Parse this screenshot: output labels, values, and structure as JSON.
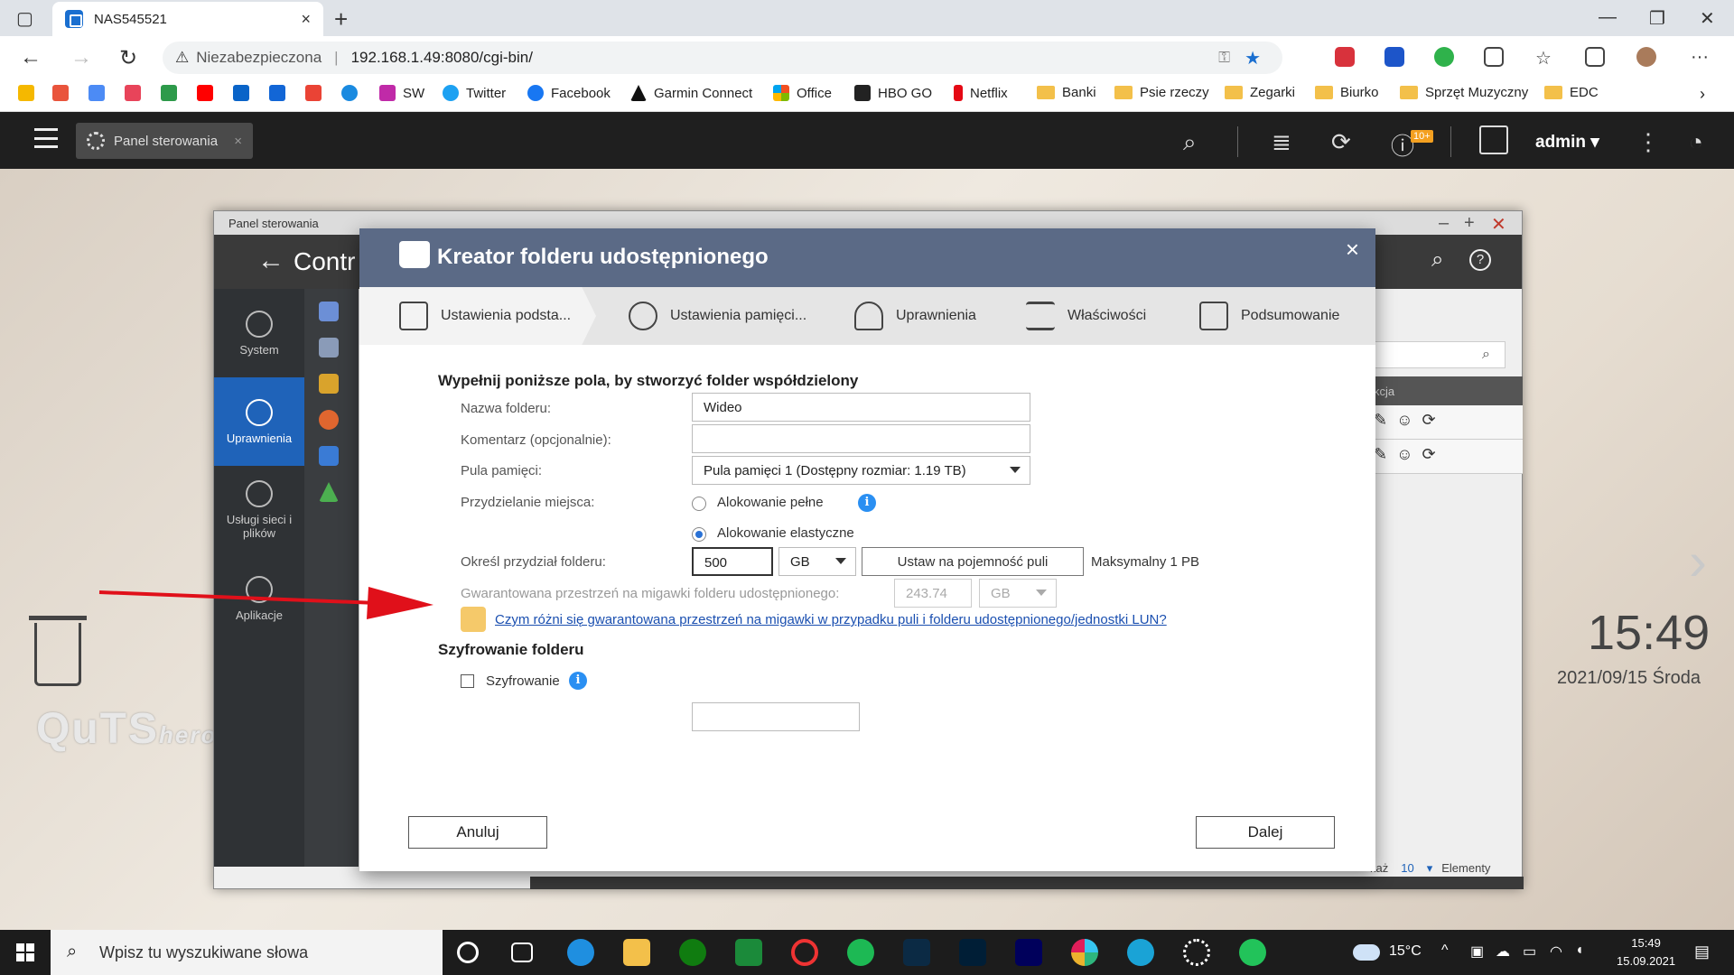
{
  "browser": {
    "tab_title": "NAS545521",
    "tab_close": "×",
    "new_tab": "+",
    "insecure_label": "Niezabezpieczona",
    "url": "192.168.1.49:8080/cgi-bin/",
    "bookmarks": [
      "SW",
      "Twitter",
      "Facebook",
      "Garmin Connect",
      "Office",
      "HBO GO",
      "Netflix",
      "Banki",
      "Psie rzeczy",
      "Zegarki",
      "Biurko",
      "Sprzęt Muzyczny",
      "EDC"
    ]
  },
  "qts": {
    "app_tab": "Panel sterowania",
    "app_tab_close": "×",
    "badge": "10+",
    "user": "admin ▾"
  },
  "control_panel": {
    "window_title": "Panel sterowania",
    "header_title": "Contr",
    "sidebar": [
      "System",
      "Uprawnienia",
      "Usługi sieci i plików",
      "Aplikacje"
    ],
    "column_header": "kcja",
    "footer_show": "każ",
    "footer_count": "10",
    "footer_items": "Elementy"
  },
  "modal": {
    "title": "Kreator folderu udostępnionego",
    "steps": [
      "Ustawienia podsta...",
      "Ustawienia pamięci...",
      "Uprawnienia",
      "Właściwości",
      "Podsumowanie"
    ],
    "heading": "Wypełnij poniższe pola, by stworzyć folder współdzielony",
    "folder_name_label": "Nazwa folderu:",
    "folder_name_value": "Wideo",
    "comment_label": "Komentarz (opcjonalnie):",
    "comment_value": "",
    "pool_label": "Pula pamięci:",
    "pool_value": "Pula pamięci 1 (Dostępny rozmiar: 1.19 TB)",
    "alloc_label": "Przydzielanie miejsca:",
    "alloc_full": "Alokowanie pełne",
    "alloc_thin": "Alokowanie elastyczne",
    "alloc_selected": "Alokowanie elastyczne",
    "quota_label": "Określ przydział folderu:",
    "quota_value": "500",
    "quota_unit": "GB",
    "set_pool_button": "Ustaw na pojemność puli",
    "max_label": "Maksymalny  1 PB",
    "snapshot_label": "Gwarantowana przestrzeń na migawki folderu udostępnionego:",
    "snapshot_value": "243.74",
    "snapshot_unit": "GB",
    "help_link": "Czym różni się gwarantowana przestrzeń na migawki w przypadku puli i folderu udostępnionego/jednostki LUN?",
    "encryption_heading": "Szyfrowanie folderu",
    "encryption_label": "Szyfrowanie",
    "encryption_checked": false,
    "cancel": "Anuluj",
    "next": "Dalej"
  },
  "desktop": {
    "brand": "QuTS",
    "brand_sub": "hero",
    "time": "15:49",
    "date": "2021/09/15 Środa"
  },
  "taskbar": {
    "search_placeholder": "Wpisz tu wyszukiwane słowa",
    "temperature": "15°C",
    "time": "15:49",
    "date": "15.09.2021"
  }
}
